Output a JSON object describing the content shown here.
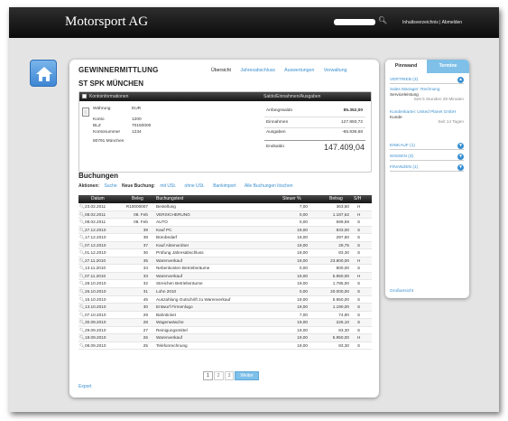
{
  "brand": "Motorsport AG",
  "search": {
    "placeholder": ""
  },
  "toplinks": {
    "inhalt": "Inhaltsverzeichnis",
    "abmelden": "Abmelden",
    "sep": "|"
  },
  "page": {
    "title": "GEWINNERMITTLUNG",
    "bank": "ST SPK MÜNCHEN"
  },
  "tabs": [
    "Übersicht",
    "Jahresabschluss",
    "Auswertungen",
    "Verwaltung"
  ],
  "konto": {
    "head_left": "Kontoinformationen",
    "head_right": "Saldo/Einnahmen/Ausgaben",
    "waehrung_label": "Währung",
    "waehrung": "EUR",
    "konto_label": "Konto",
    "konto": "1200",
    "blz_label": "BLZ",
    "blz": "70150000",
    "kontonr_label": "Kontonummer",
    "kontonr": "1234",
    "ort": "80791 München",
    "anfang_label": "Anfangssaldo",
    "anfang": "85.352,00",
    "einnahmen_label": "Einnahmen",
    "einnahmen": "127.893,72",
    "ausgaben_label": "Ausgaben",
    "ausgaben": "-65.836,68",
    "end_label": "Endsaldo",
    "end": "147.409,04"
  },
  "buchungen": {
    "title": "Buchungen",
    "actions_label": "Aktionen:",
    "suche": "Suche",
    "neue": "Neue Buchung:",
    "mit": "mit USt.",
    "ohne": "ohne USt.",
    "bank": "Bankimport",
    "loeschen": "Alle Buchungen löschen",
    "cols": {
      "datum": "Datum",
      "beleg": "Beleg",
      "text": "Buchungstext",
      "steuer": "Steuer %",
      "betrag": "Betrag",
      "sh": "S/H"
    },
    "rows": [
      [
        "23.02.2011",
        "R10000007",
        "Bestellung",
        "7,00",
        "363,50",
        "H"
      ],
      [
        "08.02.2011",
        "08. Feb",
        "VERSICHERUNG",
        "0,00",
        "1.187,62",
        "H"
      ],
      [
        "08.02.2011",
        "08. Feb",
        "AUTO",
        "0,00",
        "599,59",
        "S"
      ],
      [
        "27.12.2010",
        "39",
        "Kauf PC",
        "19,00",
        "833,00",
        "S"
      ],
      [
        "17.12.2010",
        "38",
        "Bürobedarf",
        "19,00",
        "297,50",
        "S"
      ],
      [
        "07.12.2010",
        "37",
        "Kauf Aktenordner",
        "19,00",
        "29,75",
        "S"
      ],
      [
        "01.12.2010",
        "36",
        "Prüfung Jahresabschluss",
        "19,00",
        "83,30",
        "S"
      ],
      [
        "27.11.2010",
        "35",
        "Warenverkauf",
        "19,00",
        "23.800,00",
        "H"
      ],
      [
        "13.11.2010",
        "34",
        "Nebenkosten Betriebsräume",
        "0,00",
        "800,00",
        "S"
      ],
      [
        "07.11.2010",
        "33",
        "Warenverkauf",
        "19,00",
        "5.950,00",
        "H"
      ],
      [
        "28.10.2010",
        "32",
        "Streichen Betriebsräume",
        "19,00",
        "1.785,00",
        "S"
      ],
      [
        "26.10.2010",
        "31",
        "Lohn 2010",
        "0,00",
        "20.000,00",
        "S"
      ],
      [
        "15.10.2010",
        "45",
        "Auszahlung Gutschrift zu Warenverkauf",
        "19,00",
        "5.950,00",
        "S"
      ],
      [
        "13.10.2010",
        "30",
        "Entwurf Firmenlogo",
        "19,00",
        "1.190,00",
        "S"
      ],
      [
        "07.10.2010",
        "29",
        "Bahnticket",
        "7,00",
        "74,90",
        "S"
      ],
      [
        "30.09.2010",
        "28",
        "Wagenwäsche",
        "19,00",
        "226,10",
        "S"
      ],
      [
        "29.09.2010",
        "27",
        "Reinigungsmittel",
        "19,00",
        "83,30",
        "S"
      ],
      [
        "18.09.2010",
        "26",
        "Warenverkauf",
        "19,00",
        "5.950,00",
        "H"
      ],
      [
        "08.09.2010",
        "25",
        "Telefonrechnung",
        "19,00",
        "83,30",
        "S"
      ]
    ],
    "pager": [
      "1",
      "2",
      "3"
    ],
    "weiter": "Weiter",
    "export": "Export"
  },
  "side": {
    "tab1": "Pinnwand",
    "tab2": "Termine",
    "vertrieb": "VERTRIEB (3)",
    "news": [
      {
        "link": "Sales Manager: Rechnung",
        "title": "Serviceleistung",
        "time": "Seit 5 Stunden 28 Minuten"
      },
      {
        "link": "Kundenkartei: United Planet GmbH",
        "title": "Kunde",
        "time": "Seit 14 Tagen"
      }
    ],
    "einkauf": "EINKAUF (1)",
    "wissen": "WISSEN (3)",
    "finanzen": "FINANZEN (1)",
    "footer": "Großansicht"
  },
  "colors": {
    "accent": "#3a8fd0",
    "header": "#151515",
    "home": "#4a90d9"
  }
}
